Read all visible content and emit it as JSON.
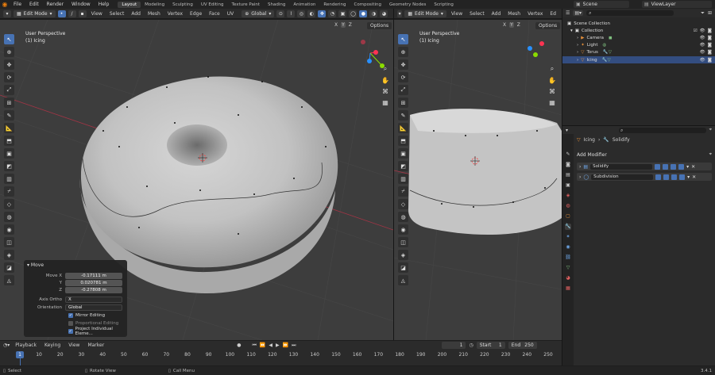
{
  "topbar": {
    "menus": [
      "File",
      "Edit",
      "Render",
      "Window",
      "Help"
    ],
    "workspaces": [
      "Layout",
      "Modeling",
      "Sculpting",
      "UV Editing",
      "Texture Paint",
      "Shading",
      "Animation",
      "Rendering",
      "Compositing",
      "Geometry Nodes",
      "Scripting"
    ],
    "active_workspace": "Layout",
    "scene": "Scene",
    "view_layer": "ViewLayer"
  },
  "viewport_left": {
    "mode": "Edit Mode",
    "menus": [
      "View",
      "Select",
      "Add",
      "Mesh",
      "Vertex",
      "Edge",
      "Face",
      "UV"
    ],
    "orientation": "Global",
    "perspective": "User Perspective",
    "object": "(1) Icing",
    "options": "Options",
    "xyz": [
      "X",
      "Y",
      "Z"
    ]
  },
  "viewport_right": {
    "mode": "Edit Mode",
    "menus": [
      "View",
      "Select",
      "Add",
      "Mesh",
      "Vertex",
      "Ed"
    ],
    "perspective": "User Perspective",
    "object": "(1) Icing",
    "options": "Options",
    "xyz": [
      "X",
      "Y",
      "Z"
    ]
  },
  "move_panel": {
    "title": "Move",
    "move_x_label": "Move X",
    "move_x": "-0.17111 m",
    "y_label": "Y",
    "y": "0.020781 m",
    "z_label": "Z",
    "z": "-0.27808 m",
    "axis_ortho_label": "Axis Ortho",
    "axis_ortho": "X",
    "orientation_label": "Orientation",
    "orientation": "Global",
    "mirror_editing": "Mirror Editing",
    "proportional_editing": "Proportional Editing",
    "project_individual": "Project Individual Eleme..."
  },
  "outliner": {
    "search_placeholder": "",
    "items": [
      {
        "label": "Scene Collection",
        "indent": 0
      },
      {
        "label": "Collection",
        "indent": 1
      },
      {
        "label": "Camera",
        "indent": 2
      },
      {
        "label": "Light",
        "indent": 2
      },
      {
        "label": "Torus",
        "indent": 2
      },
      {
        "label": "Icing",
        "indent": 2
      }
    ]
  },
  "properties": {
    "breadcrumb_object": "Icing",
    "breadcrumb_modifier": "Solidify",
    "add_modifier": "Add Modifier",
    "modifiers": [
      "Solidify",
      "Subdivision"
    ]
  },
  "timeline": {
    "menus": [
      "Playback",
      "Keying",
      "View",
      "Marker"
    ],
    "current_frame": "1",
    "start_label": "Start",
    "start": "1",
    "end_label": "End",
    "end": "250",
    "frame_labels": [
      "1",
      "10",
      "20",
      "30",
      "40",
      "50",
      "60",
      "70",
      "80",
      "90",
      "100",
      "110",
      "120",
      "130",
      "140",
      "150",
      "160",
      "170",
      "180",
      "190",
      "200",
      "210",
      "220",
      "230",
      "240",
      "250"
    ]
  },
  "statusbar": {
    "select": "Select",
    "rotate": "Rotate View",
    "call_menu": "Call Menu",
    "version": "3.4.1"
  },
  "colors": {
    "accent": "#4772b3",
    "viewport": "#3d3d3d",
    "x_axis": "#ff3352",
    "y_axis": "#8bdc00",
    "z_axis": "#2890ff"
  }
}
